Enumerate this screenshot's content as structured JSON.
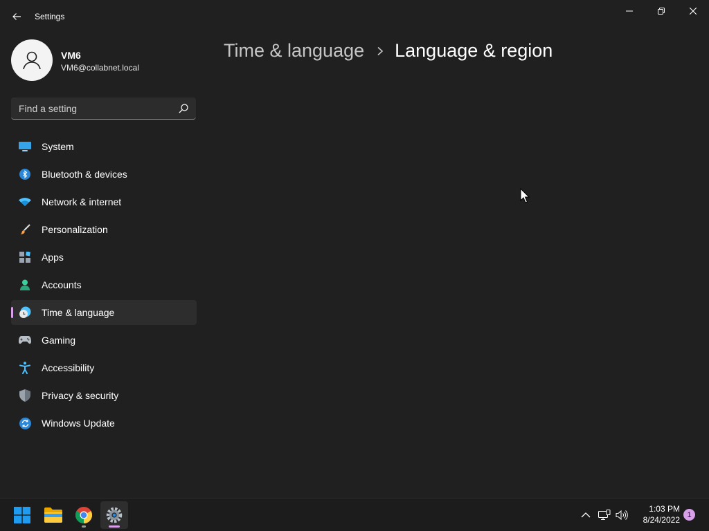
{
  "window": {
    "title": "Settings"
  },
  "profile": {
    "name": "VM6",
    "email": "VM6@collabnet.local"
  },
  "search": {
    "placeholder": "Find a setting"
  },
  "nav": {
    "items": [
      {
        "label": "System",
        "icon": "system-icon"
      },
      {
        "label": "Bluetooth & devices",
        "icon": "bluetooth-icon"
      },
      {
        "label": "Network & internet",
        "icon": "wifi-icon"
      },
      {
        "label": "Personalization",
        "icon": "brush-icon"
      },
      {
        "label": "Apps",
        "icon": "apps-icon"
      },
      {
        "label": "Accounts",
        "icon": "accounts-icon"
      },
      {
        "label": "Time & language",
        "icon": "time-language-icon",
        "selected": true
      },
      {
        "label": "Gaming",
        "icon": "gamepad-icon"
      },
      {
        "label": "Accessibility",
        "icon": "accessibility-icon"
      },
      {
        "label": "Privacy & security",
        "icon": "shield-icon"
      },
      {
        "label": "Windows Update",
        "icon": "update-icon"
      }
    ]
  },
  "breadcrumb": {
    "parent": "Time & language",
    "current": "Language & region"
  },
  "taskbar": {
    "apps": [
      "start-icon",
      "file-explorer-icon",
      "chrome-icon",
      "settings-icon"
    ],
    "clock": {
      "time": "1:03 PM",
      "date": "8/24/2022"
    },
    "notification_count": "1"
  },
  "colors": {
    "accent": "#d7a0e8",
    "background": "#202020",
    "selected_item": "#2d2d2d"
  }
}
